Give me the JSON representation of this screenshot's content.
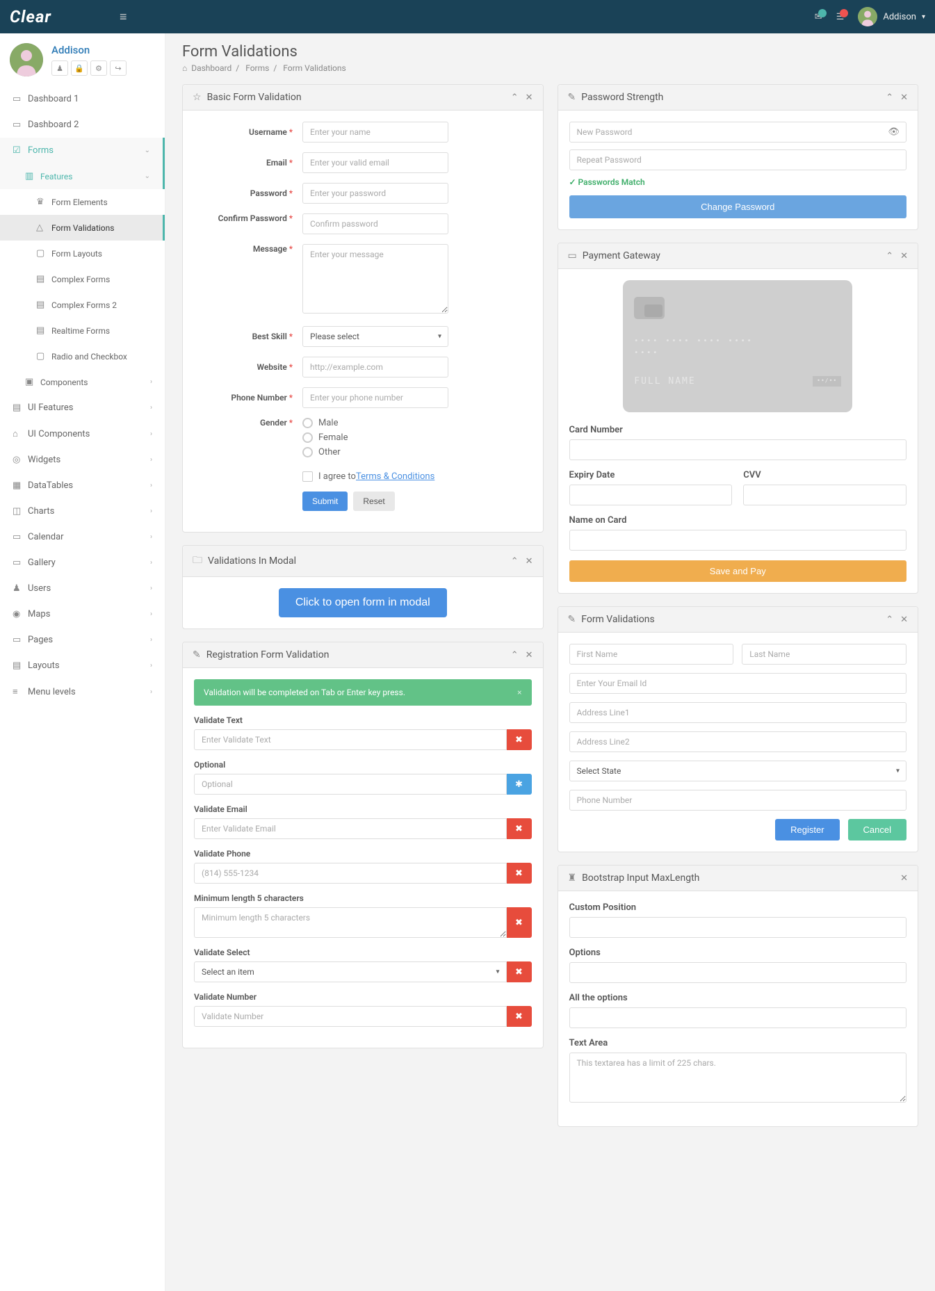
{
  "brand": "Clear",
  "header": {
    "user": "Addison",
    "mail_badge": "",
    "task_badge": ""
  },
  "sidebar": {
    "user": "Addison",
    "items": [
      {
        "label": "Dashboard 1",
        "icon": "▭"
      },
      {
        "label": "Dashboard 2",
        "icon": "▭"
      },
      {
        "label": "Forms",
        "icon": "☑",
        "active": true
      },
      {
        "label": "Features",
        "icon": "▥",
        "sub": true,
        "active": true
      },
      {
        "label": "Form Elements",
        "icon": "♛",
        "sub2": true
      },
      {
        "label": "Form Validations",
        "icon": "△",
        "sub2": true,
        "highlight": true
      },
      {
        "label": "Form Layouts",
        "icon": "▢",
        "sub2": true
      },
      {
        "label": "Complex Forms",
        "icon": "▤",
        "sub2": true
      },
      {
        "label": "Complex Forms 2",
        "icon": "▤",
        "sub2": true
      },
      {
        "label": "Realtime Forms",
        "icon": "▤",
        "sub2": true
      },
      {
        "label": "Radio and Checkbox",
        "icon": "▢",
        "sub2": true
      },
      {
        "label": "Components",
        "icon": "▣",
        "sub": true,
        "chev": true
      },
      {
        "label": "UI Features",
        "icon": "▤",
        "chev": true
      },
      {
        "label": "UI Components",
        "icon": "⌂",
        "chev": true
      },
      {
        "label": "Widgets",
        "icon": "◎",
        "chev": true
      },
      {
        "label": "DataTables",
        "icon": "▦",
        "chev": true
      },
      {
        "label": "Charts",
        "icon": "◫",
        "chev": true
      },
      {
        "label": "Calendar",
        "icon": "▭",
        "chev": true
      },
      {
        "label": "Gallery",
        "icon": "▭",
        "chev": true
      },
      {
        "label": "Users",
        "icon": "♟",
        "chev": true
      },
      {
        "label": "Maps",
        "icon": "◉",
        "chev": true
      },
      {
        "label": "Pages",
        "icon": "▭",
        "chev": true
      },
      {
        "label": "Layouts",
        "icon": "▤",
        "chev": true
      },
      {
        "label": "Menu levels",
        "icon": "≡",
        "chev": true
      }
    ]
  },
  "page": {
    "title": "Form Validations",
    "crumbs": [
      "Dashboard",
      "Forms",
      "Form Validations"
    ]
  },
  "basic": {
    "title": "Basic Form Validation",
    "labels": {
      "username": "Username",
      "email": "Email",
      "password": "Password",
      "confirm": "Confirm Password",
      "message": "Message",
      "skill": "Best Skill",
      "website": "Website",
      "phone": "Phone Number",
      "gender": "Gender"
    },
    "ph": {
      "username": "Enter your name",
      "email": "Enter your valid email",
      "password": "Enter your password",
      "confirm": "Confirm password",
      "message": "Enter your message",
      "website": "http://example.com",
      "phone": "Enter your phone number"
    },
    "skill_selected": "Please select",
    "genders": [
      "Male",
      "Female",
      "Other"
    ],
    "agree_pre": "I agree to ",
    "agree_link": "Terms & Conditions",
    "submit": "Submit",
    "reset": "Reset"
  },
  "modal": {
    "title": "Validations In Modal",
    "button": "Click to open form in modal"
  },
  "reg": {
    "title": "Registration Form Validation",
    "alert": "Validation will be completed on Tab or Enter key press.",
    "fields": {
      "vtext": "Validate Text",
      "optional": "Optional",
      "vemail": "Validate Email",
      "vphone": "Validate Phone",
      "minlen": "Minimum length 5 characters",
      "vselect": "Validate Select",
      "vnumber": "Validate Number"
    },
    "ph": {
      "vtext": "Enter Validate Text",
      "optional": "Optional",
      "vemail": "Enter Validate Email",
      "vphone": "(814) 555-1234",
      "minlen": "Minimum length 5 characters",
      "vselect": "Select an item",
      "vnumber": "Validate Number"
    }
  },
  "pw": {
    "title": "Password Strength",
    "ph_new": "New Password",
    "ph_repeat": "Repeat Password",
    "match": "Passwords Match",
    "button": "Change Password"
  },
  "pay": {
    "title": "Payment Gateway",
    "cc_num": "•••• •••• •••• ••••",
    "name": "FULL NAME",
    "sig": "••/••",
    "labels": {
      "card": "Card Number",
      "exp": "Expiry Date",
      "cvv": "CVV",
      "name": "Name on Card"
    },
    "button": "Save and Pay"
  },
  "fv": {
    "title": "Form Validations",
    "ph": {
      "first": "First Name",
      "last": "Last Name",
      "email": "Enter Your Email Id",
      "addr1": "Address Line1",
      "addr2": "Address Line2",
      "state": "Select State",
      "phone": "Phone Number"
    },
    "register": "Register",
    "cancel": "Cancel"
  },
  "maxlen": {
    "title": "Bootstrap Input MaxLength",
    "labels": {
      "pos": "Custom Position",
      "opts": "Options",
      "allopts": "All the options",
      "ta": "Text Area"
    },
    "ta_ph": "This textarea has a limit of 225 chars."
  }
}
